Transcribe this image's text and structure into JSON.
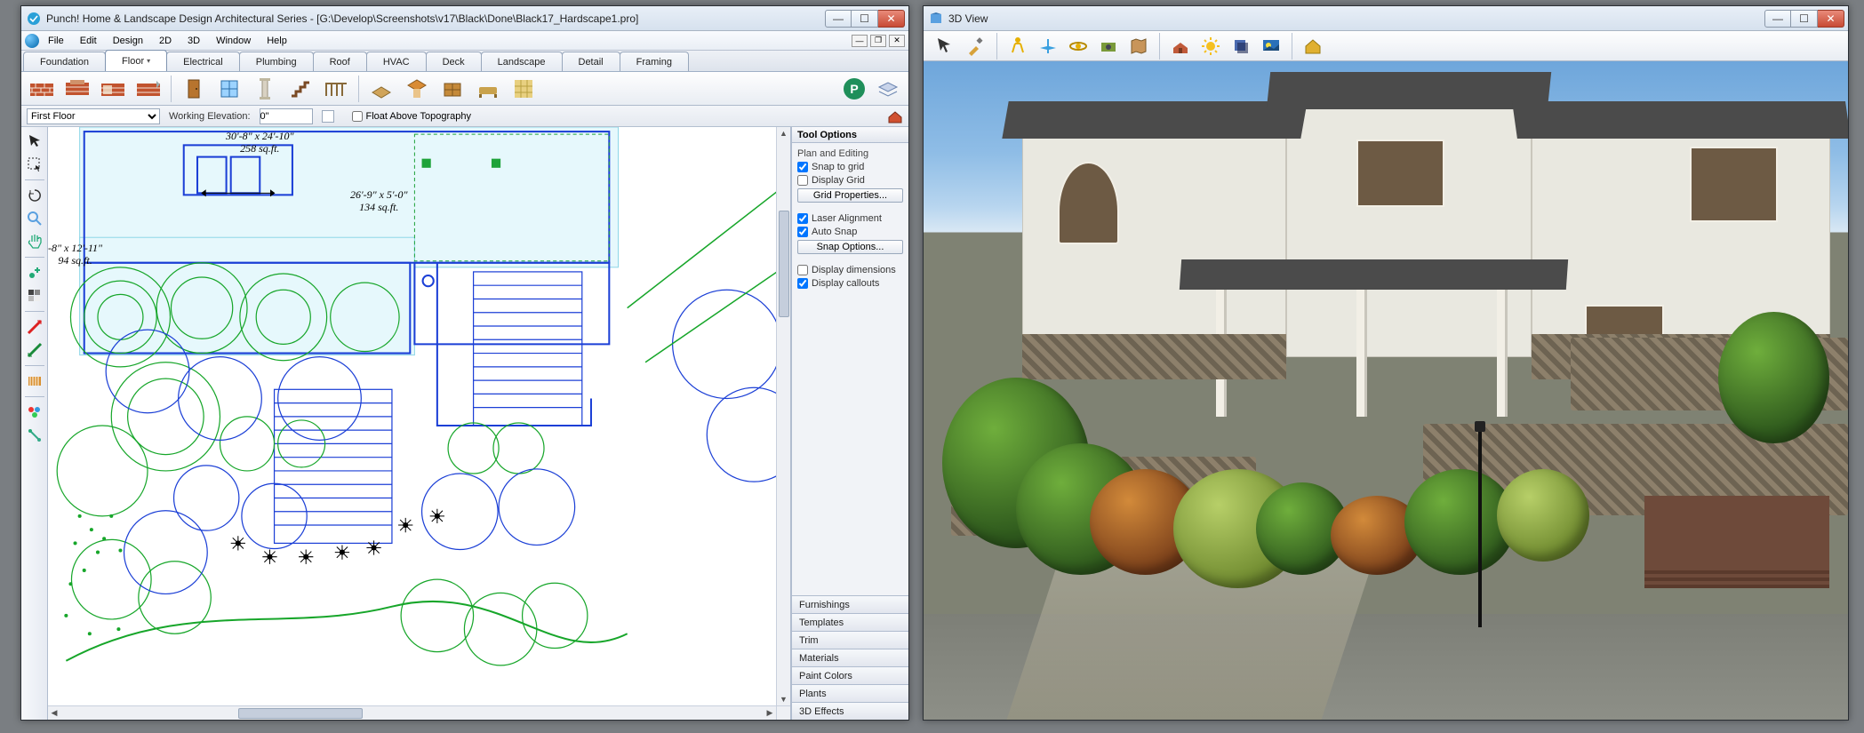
{
  "app": {
    "title": "Punch! Home & Landscape Design Architectural Series - [G:\\Develop\\Screenshots\\v17\\Black\\Done\\Black17_Hardscape1.pro]"
  },
  "menu": {
    "items": [
      "File",
      "Edit",
      "Design",
      "2D",
      "3D",
      "Window",
      "Help"
    ]
  },
  "tabs": [
    "Foundation",
    "Floor",
    "Electrical",
    "Plumbing",
    "Roof",
    "HVAC",
    "Deck",
    "Landscape",
    "Detail",
    "Framing"
  ],
  "tabs_active_index": 1,
  "subbar": {
    "floor_selector": "First Floor",
    "working_elev_label": "Working Elevation:",
    "working_elev_value": "0\"",
    "float_above_label": "Float Above Topography"
  },
  "dimensions": {
    "a": {
      "size": "30'-8\" x 24'-10\"",
      "area": "258 sq.ft."
    },
    "b": {
      "size": "26'-9\" x 5'-0\"",
      "area": "134 sq.ft."
    },
    "c": {
      "size": "-8\" x 12'-11\"",
      "area": "94 sq.ft."
    }
  },
  "tool_options": {
    "header": "Tool Options",
    "section": "Plan and Editing",
    "snap_to_grid": "Snap to grid",
    "display_grid": "Display Grid",
    "grid_props_btn": "Grid Properties...",
    "laser_align": "Laser Alignment",
    "auto_snap": "Auto Snap",
    "snap_opts_btn": "Snap Options...",
    "disp_dims": "Display dimensions",
    "disp_callouts": "Display callouts",
    "checks": {
      "snap_to_grid": true,
      "display_grid": false,
      "laser_align": true,
      "auto_snap": true,
      "disp_dims": false,
      "disp_callouts": true
    }
  },
  "accordion": [
    "Furnishings",
    "Templates",
    "Trim",
    "Materials",
    "Paint Colors",
    "Plants",
    "3D Effects"
  ],
  "view3d": {
    "title": "3D View"
  }
}
